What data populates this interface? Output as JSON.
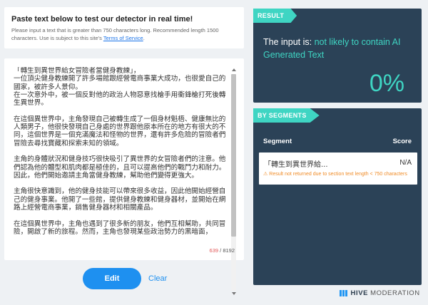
{
  "header": {
    "title": "Paste text below to test our detector in real time!",
    "description": "Please input a text that is greater than 750 characters long. Recommended length 1500 characters. Use is subject to this site's ",
    "tos_link": "Terms of Service",
    "tos_suffix": "."
  },
  "editor": {
    "text": "「轉生到異世界給女冒險者當健身教練」，\n一位頂尖健身教練開了許多場館跟經營電商事業大成功，也很愛自己的國家，被許多人景仰。\n在一次意外中，被一個反對他的政治人物惡意找槍手用衝鋒槍打死後轉生異世界。\n\n在這個異世界中，主角發現自己被轉生成了一個身材魁梧、健康無比的人類男子，他很快發現自己身處的世界跟他原本所在的地方有很大的不同，這個世界是一個充滿魔法和怪物的世界，還有許多危險的冒險者們冒險去尋找寶藏和探索未知的領域。\n\n主角的身體狀況和健身技巧很快吸引了異世界的女冒險者們的注意。他們認為他的體型和肌肉都是極佳的，且可以提高他們的戰鬥力和耐力。因此，他們開始邀請主角當健身教練，幫助他們變得更強大。\n\n主角很快意識到，他的健身技能可以帶來很多收益，因此他開始經營自己的健身事業。他開了一些館，提供健身教練和健身器材，並開始在網路上經營電商事業，銷售健身器材和相關產品。\n\n在這個異世界中，主角也遇到了很多新的朋友，他們互相幫助，共同冒險，開啟了新的旅程。然而，主角也發現某些政治勢力的黑暗面，",
    "char_count_current": "639",
    "char_count_total": " / 8192"
  },
  "actions": {
    "edit_label": "Edit",
    "clear_label": "Clear"
  },
  "result": {
    "tag": "RESULT",
    "prefix": "The input is: ",
    "verdict": "not likely to contain AI Generated Text",
    "percent": "0%"
  },
  "segments": {
    "tag": "BY SEGMENTS",
    "col_segment": "Segment",
    "col_score": "Score",
    "rows": [
      {
        "text": "「轉生到異世界給...",
        "score": "N/A",
        "warning": "Result not returned due to section text length < 750 characters"
      }
    ]
  },
  "brand": {
    "name_bold": "HIVE",
    "name_rest": "MODERATION"
  },
  "colors": {
    "accent_teal": "#3fd5c3",
    "panel_bg": "#2b4257",
    "button_blue": "#1e90f0",
    "warning_orange": "#f08c28"
  }
}
